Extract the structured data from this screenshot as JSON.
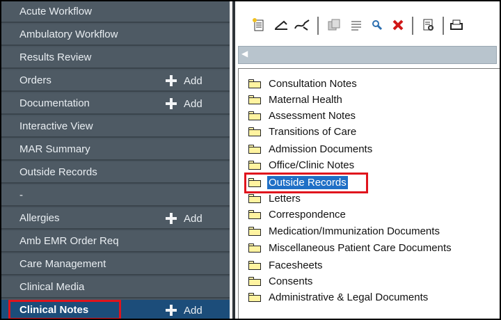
{
  "nav": {
    "add_label": "Add",
    "items": [
      {
        "label": "Acute Workflow"
      },
      {
        "label": "Ambulatory Workflow"
      },
      {
        "label": "Results Review"
      },
      {
        "label": "Orders"
      },
      {
        "label": "Documentation"
      },
      {
        "label": "Interactive View"
      },
      {
        "label": "MAR Summary"
      },
      {
        "label": "Outside Records"
      },
      {
        "label": "-"
      },
      {
        "label": "Allergies"
      },
      {
        "label": "Amb EMR Order Req"
      },
      {
        "label": "Care Management"
      },
      {
        "label": "Clinical Media"
      },
      {
        "label": "Clinical Notes"
      }
    ],
    "active_item": "Clinical Notes"
  },
  "toolbar": {
    "icons": [
      "new-note-icon",
      "sign-icon",
      "forward-icon",
      "copy-icon",
      "list-icon",
      "search-icon",
      "delete-icon",
      "preview-icon",
      "print-icon"
    ]
  },
  "tree": {
    "selected": "Outside Records",
    "folders": [
      {
        "label": "Consultation Notes"
      },
      {
        "label": "Maternal Health"
      },
      {
        "label": "Assessment Notes"
      },
      {
        "label": "Transitions of Care"
      },
      {
        "label": "Admission Documents"
      },
      {
        "label": "Office/Clinic Notes"
      },
      {
        "label": "Outside Records"
      },
      {
        "label": "Letters"
      },
      {
        "label": "Correspondence"
      },
      {
        "label": "Medication/Immunization Documents"
      },
      {
        "label": "Miscellaneous Patient Care Documents"
      },
      {
        "label": "Facesheets"
      },
      {
        "label": "Consents"
      },
      {
        "label": "Administrative & Legal Documents"
      }
    ]
  },
  "colors": {
    "nav_bg": "#4e5a64",
    "nav_active": "#1c4d7a",
    "highlight_box": "#e0141d",
    "selection": "#1f6fc6"
  }
}
